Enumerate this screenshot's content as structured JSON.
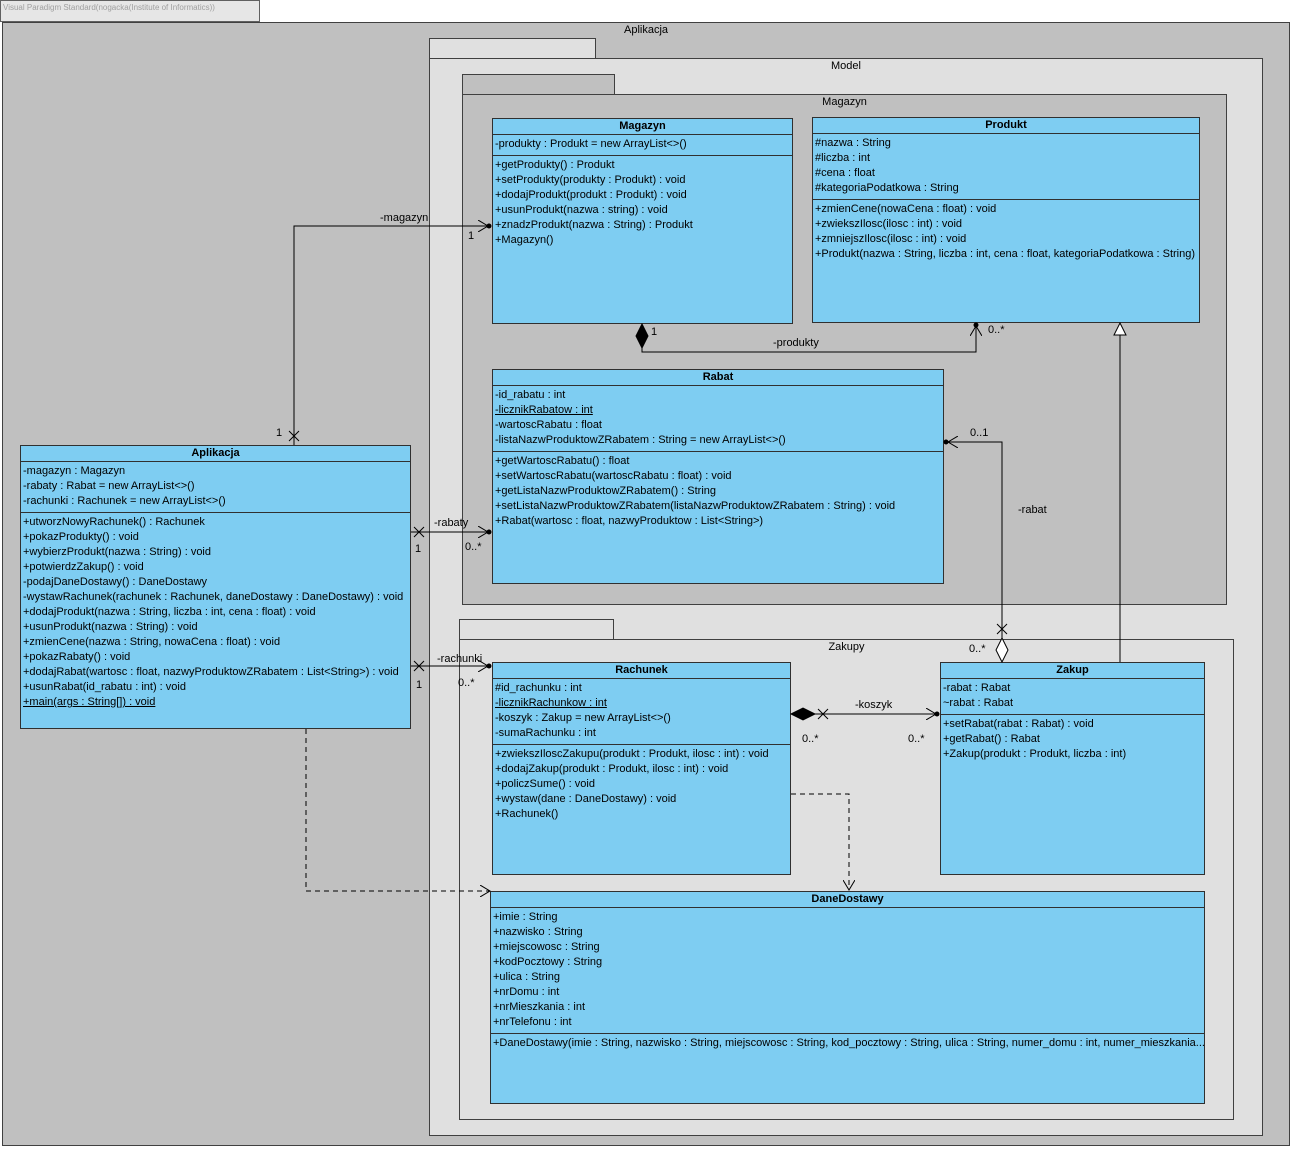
{
  "watermark": "Visual Paradigm Standard(nogacka(Institute of Informatics))",
  "packages": {
    "aplikacja": "Aplikacja",
    "model": "Model",
    "magazyn": "Magazyn",
    "zakupy": "Zakupy"
  },
  "classes": {
    "magazyn": {
      "name": "Magazyn",
      "attributes": [
        "-produkty : Produkt = new ArrayList<>()"
      ],
      "operations": [
        "+getProdukty() : Produkt",
        "+setProdukty(produkty : Produkt) : void",
        "+dodajProdukt(produkt : Produkt) : void",
        "+usunProdukt(nazwa : string) : void",
        "+znadzProdukt(nazwa : String) : Produkt",
        "+Magazyn()"
      ]
    },
    "produkt": {
      "name": "Produkt",
      "attributes": [
        "#nazwa : String",
        "#liczba : int",
        "#cena : float",
        "#kategoriaPodatkowa : String"
      ],
      "operations": [
        "+zmienCene(nowaCena : float) : void",
        "+zwiekszIlosc(ilosc : int) : void",
        "+zmniejszIlosc(ilosc : int) : void",
        "+Produkt(nazwa : String, liczba : int, cena : float, kategoriaPodatkowa : String)"
      ]
    },
    "rabat": {
      "name": "Rabat",
      "attributes": [
        "-id_rabatu : int",
        "-licznikRabatow : int",
        "-wartoscRabatu : float",
        "-listaNazwProduktowZRabatem : String = new ArrayList<>()"
      ],
      "operations": [
        "+getWartoscRabatu() : float",
        "+setWartoscRabatu(wartoscRabatu : float) : void",
        "+getListaNazwProduktowZRabatem() : String",
        "+setListaNazwProduktowZRabatem(listaNazwProduktowZRabatem : String) : void",
        "+Rabat(wartosc : float, nazwyProduktow : List<String>)"
      ]
    },
    "aplikacja": {
      "name": "Aplikacja",
      "attributes": [
        "-magazyn : Magazyn",
        "-rabaty : Rabat = new ArrayList<>()",
        "-rachunki : Rachunek = new ArrayList<>()"
      ],
      "operations": [
        "+utworzNowyRachunek() : Rachunek",
        "+pokazProdukty() : void",
        "+wybierzProdukt(nazwa : String) : void",
        "+potwierdzZakup() : void",
        "-podajDaneDostawy() : DaneDostawy",
        "-wystawRachunek(rachunek : Rachunek, daneDostawy : DaneDostawy) : void",
        "+dodajProdukt(nazwa : String, liczba : int, cena : float) : void",
        "+usunProdukt(nazwa : String) : void",
        "+zmienCene(nazwa : String, nowaCena : float) : void",
        "+pokazRabaty() : void",
        "+dodajRabat(wartosc : float, nazwyProduktowZRabatem : List<String>) : void",
        "+usunRabat(id_rabatu : int) : void",
        "+main(args : String[]) : void"
      ]
    },
    "rachunek": {
      "name": "Rachunek",
      "attributes": [
        "#id_rachunku : int",
        "-licznikRachunkow : int",
        "-koszyk : Zakup = new ArrayList<>()",
        "-sumaRachunku : int"
      ],
      "operations": [
        "+zwiekszIloscZakupu(produkt : Produkt, ilosc : int) : void",
        "+dodajZakup(produkt : Produkt, ilosc : int) : void",
        "+policzSume() : void",
        "+wystaw(dane : DaneDostawy) : void",
        "+Rachunek()"
      ]
    },
    "zakup": {
      "name": "Zakup",
      "attributes": [
        " -rabat : Rabat",
        "~rabat : Rabat"
      ],
      "operations": [
        "+setRabat(rabat : Rabat) : void",
        "+getRabat() : Rabat",
        "+Zakup(produkt : Produkt, liczba : int)"
      ]
    },
    "daneDostawy": {
      "name": "DaneDostawy",
      "attributes": [
        "+imie : String",
        "+nazwisko : String",
        "+miejscowosc : String",
        "+kodPocztowy : String",
        "+ulica : String",
        "+nrDomu : int",
        "+nrMieszkania : int",
        "+nrTelefonu : int"
      ],
      "operations": [
        "+DaneDostawy(imie : String, nazwisko : String, miejscowosc : String, kod_pocztowy : String, ulica : String, numer_domu : int, numer_mieszkania..."
      ]
    }
  },
  "associations": {
    "magazyn": {
      "role": "-magazyn",
      "source_mult": "1",
      "target_mult": "1"
    },
    "produkty": {
      "role": "-produkty",
      "source_mult": "1",
      "target_mult": "0..*"
    },
    "rabaty": {
      "role": "-rabaty",
      "source_mult": "1",
      "target_mult": "0..*"
    },
    "rachunki": {
      "role": "-rachunki",
      "source_mult": "1",
      "target_mult": "0..*"
    },
    "rabat": {
      "role": "-rabat",
      "source_mult": "0..*",
      "target_mult": "0..1"
    },
    "koszyk": {
      "role": "-koszyk",
      "source_mult": "0..*",
      "target_mult": "0..*"
    }
  },
  "colors": {
    "class_fill": "#7ecdf2",
    "package_dark": "#c0c0c0",
    "package_light": "#e0e0e0",
    "line": "#000000"
  }
}
